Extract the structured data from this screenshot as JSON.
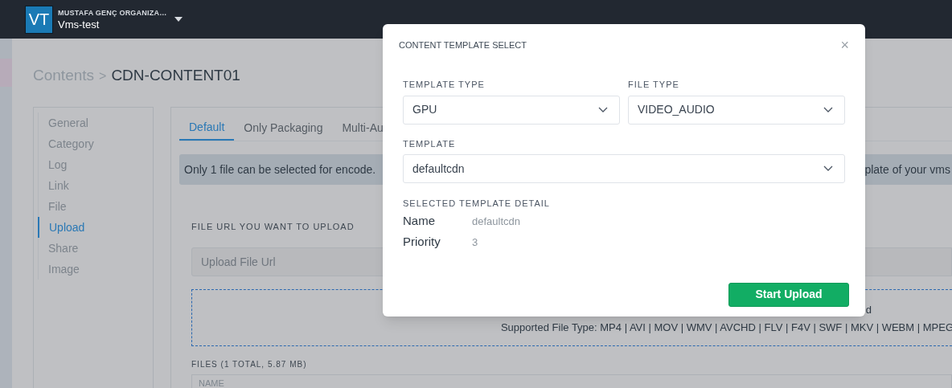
{
  "topbar": {
    "logo": "VT",
    "organization": "MUSTAFA GENÇ ORGANIZA…",
    "project": "Vms-test"
  },
  "breadcrumb": {
    "parent": "Contents",
    "separator": ">",
    "current": "CDN-CONTENT01"
  },
  "side_nav": [
    {
      "label": "General",
      "selected": false
    },
    {
      "label": "Category",
      "selected": false
    },
    {
      "label": "Log",
      "selected": false
    },
    {
      "label": "Link",
      "selected": false
    },
    {
      "label": "File",
      "selected": false
    },
    {
      "label": "Upload",
      "selected": true
    },
    {
      "label": "Share",
      "selected": false
    },
    {
      "label": "Image",
      "selected": false
    }
  ],
  "tabs": [
    {
      "label": "Default",
      "selected": true
    },
    {
      "label": "Only Packaging",
      "selected": false
    },
    {
      "label": "Multi-Au",
      "selected": false
    }
  ],
  "notice": {
    "text_left": "Only 1 file can be selected for encode.",
    "text_right": "plate of your vms"
  },
  "upload": {
    "label": "FILE URL YOU WANT TO UPLOAD",
    "url_field": {
      "placeholder": "Upload File Url"
    },
    "dropzone": {
      "text_fragment": "d",
      "supported_types": "Supported File Type: MP4 | AVI | MOV | WMV | AVCHD | FLV | F4V | SWF | MKV | WEBM | MPEG"
    }
  },
  "files": {
    "label": "FILES (1 TOTAL, 5.87 MB)",
    "columns": [
      "NAME"
    ]
  },
  "modal": {
    "title": "CONTENT TEMPLATE SELECT",
    "close": "×",
    "selects": [
      {
        "label": "TEMPLATE TYPE",
        "value": "GPU"
      },
      {
        "label": "FILE TYPE",
        "value": "VIDEO_AUDIO"
      },
      {
        "label": "TEMPLATE",
        "value": "defaultcdn"
      }
    ],
    "detail_heading": "SELECTED TEMPLATE DETAIL",
    "details": [
      {
        "label": "Name",
        "value": "defaultcdn"
      },
      {
        "label": "Priority",
        "value": "3"
      }
    ],
    "button": "Start Upload"
  }
}
